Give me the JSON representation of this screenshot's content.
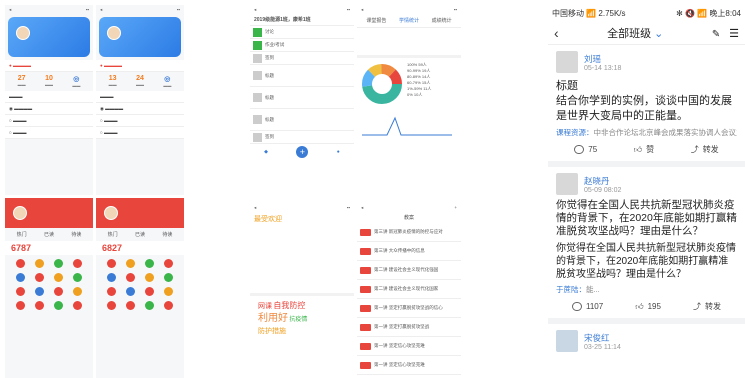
{
  "left": {
    "stats1": [
      {
        "v": "27",
        "l": ""
      },
      {
        "v": "10",
        "l": ""
      },
      {
        "v": "",
        "l": ""
      }
    ],
    "stats2": [
      {
        "v": "13",
        "l": ""
      },
      {
        "v": "24",
        "l": ""
      },
      {
        "v": "",
        "l": ""
      }
    ],
    "big1": "6787",
    "big2": "6827",
    "tabs1": [
      "热门",
      "已读",
      "待读"
    ]
  },
  "middle": {
    "title1": "2019级能源1班，康希1班",
    "items1": [
      "讨论",
      "作业/考试",
      "签到",
      "标题",
      "标题",
      "标题",
      "签到"
    ],
    "tabs2": [
      "课堂报告",
      "学情统计",
      "成绩统计"
    ],
    "chart_legend": [
      {
        "label": "100%",
        "n": "59人"
      },
      {
        "label": "90-99%",
        "n": "19人"
      },
      {
        "label": "80-89%",
        "n": "14人"
      },
      {
        "label": "60-79%",
        "n": "15人"
      },
      {
        "label": "1%-59%",
        "n": "11人"
      },
      {
        "label": "0%",
        "n": "10人"
      }
    ],
    "words": [
      "最受欢迎",
      "自我防控",
      "利用好",
      "抗疫情",
      "防护措施",
      "网课"
    ],
    "list_title": "教案",
    "list": [
      "第三讲 新冠肺炎疫情的防控与应对",
      "第三讲 大众传播中的信息",
      "第二讲 建设社会主义现代化强国",
      "第二讲 建设社会主义现代化国家",
      "第一讲 坚定打赢脱贫攻坚战的信心",
      "第一讲 坚定打赢脱贫攻坚战",
      "第一讲 坚定信心攻坚克难",
      "第一讲 坚定信心攻坚克难"
    ]
  },
  "right": {
    "status_left": "中国移动 📶 2.75K/s",
    "status_right": "✻ 🔇 📶 晚上8:04",
    "nav_title": "全部班级",
    "posts": [
      {
        "name": "刘瑶",
        "time": "05-14 13:18",
        "title": "标题",
        "body": "结合你学到的实例，谈谈中国的发展是世界大变局中的正能量。",
        "meta_label": "课程资源：",
        "meta": "中非合作论坛北京峰会成果落实协调人会议主席声...",
        "c1": "75",
        "c2": "赞",
        "c3": "转发"
      },
      {
        "name": "赵晓丹",
        "time": "05-09 08:02",
        "title": "你觉得在全国人民共抗新型冠状肺炎疫情的背景下，在2020年底能如期打赢精准脱贫攻坚战吗？理由是什么？",
        "body": "你觉得在全国人民共抗新型冠状肺炎疫情的背景下，在2020年底能如期打赢精准脱贫攻坚战吗？理由是什么？",
        "meta_label": "于蔗陆：",
        "meta": "能...",
        "c1": "1107",
        "c2": "195",
        "c3": "转发"
      },
      {
        "name": "宋俊红",
        "time": "03-25 11:14"
      }
    ]
  }
}
